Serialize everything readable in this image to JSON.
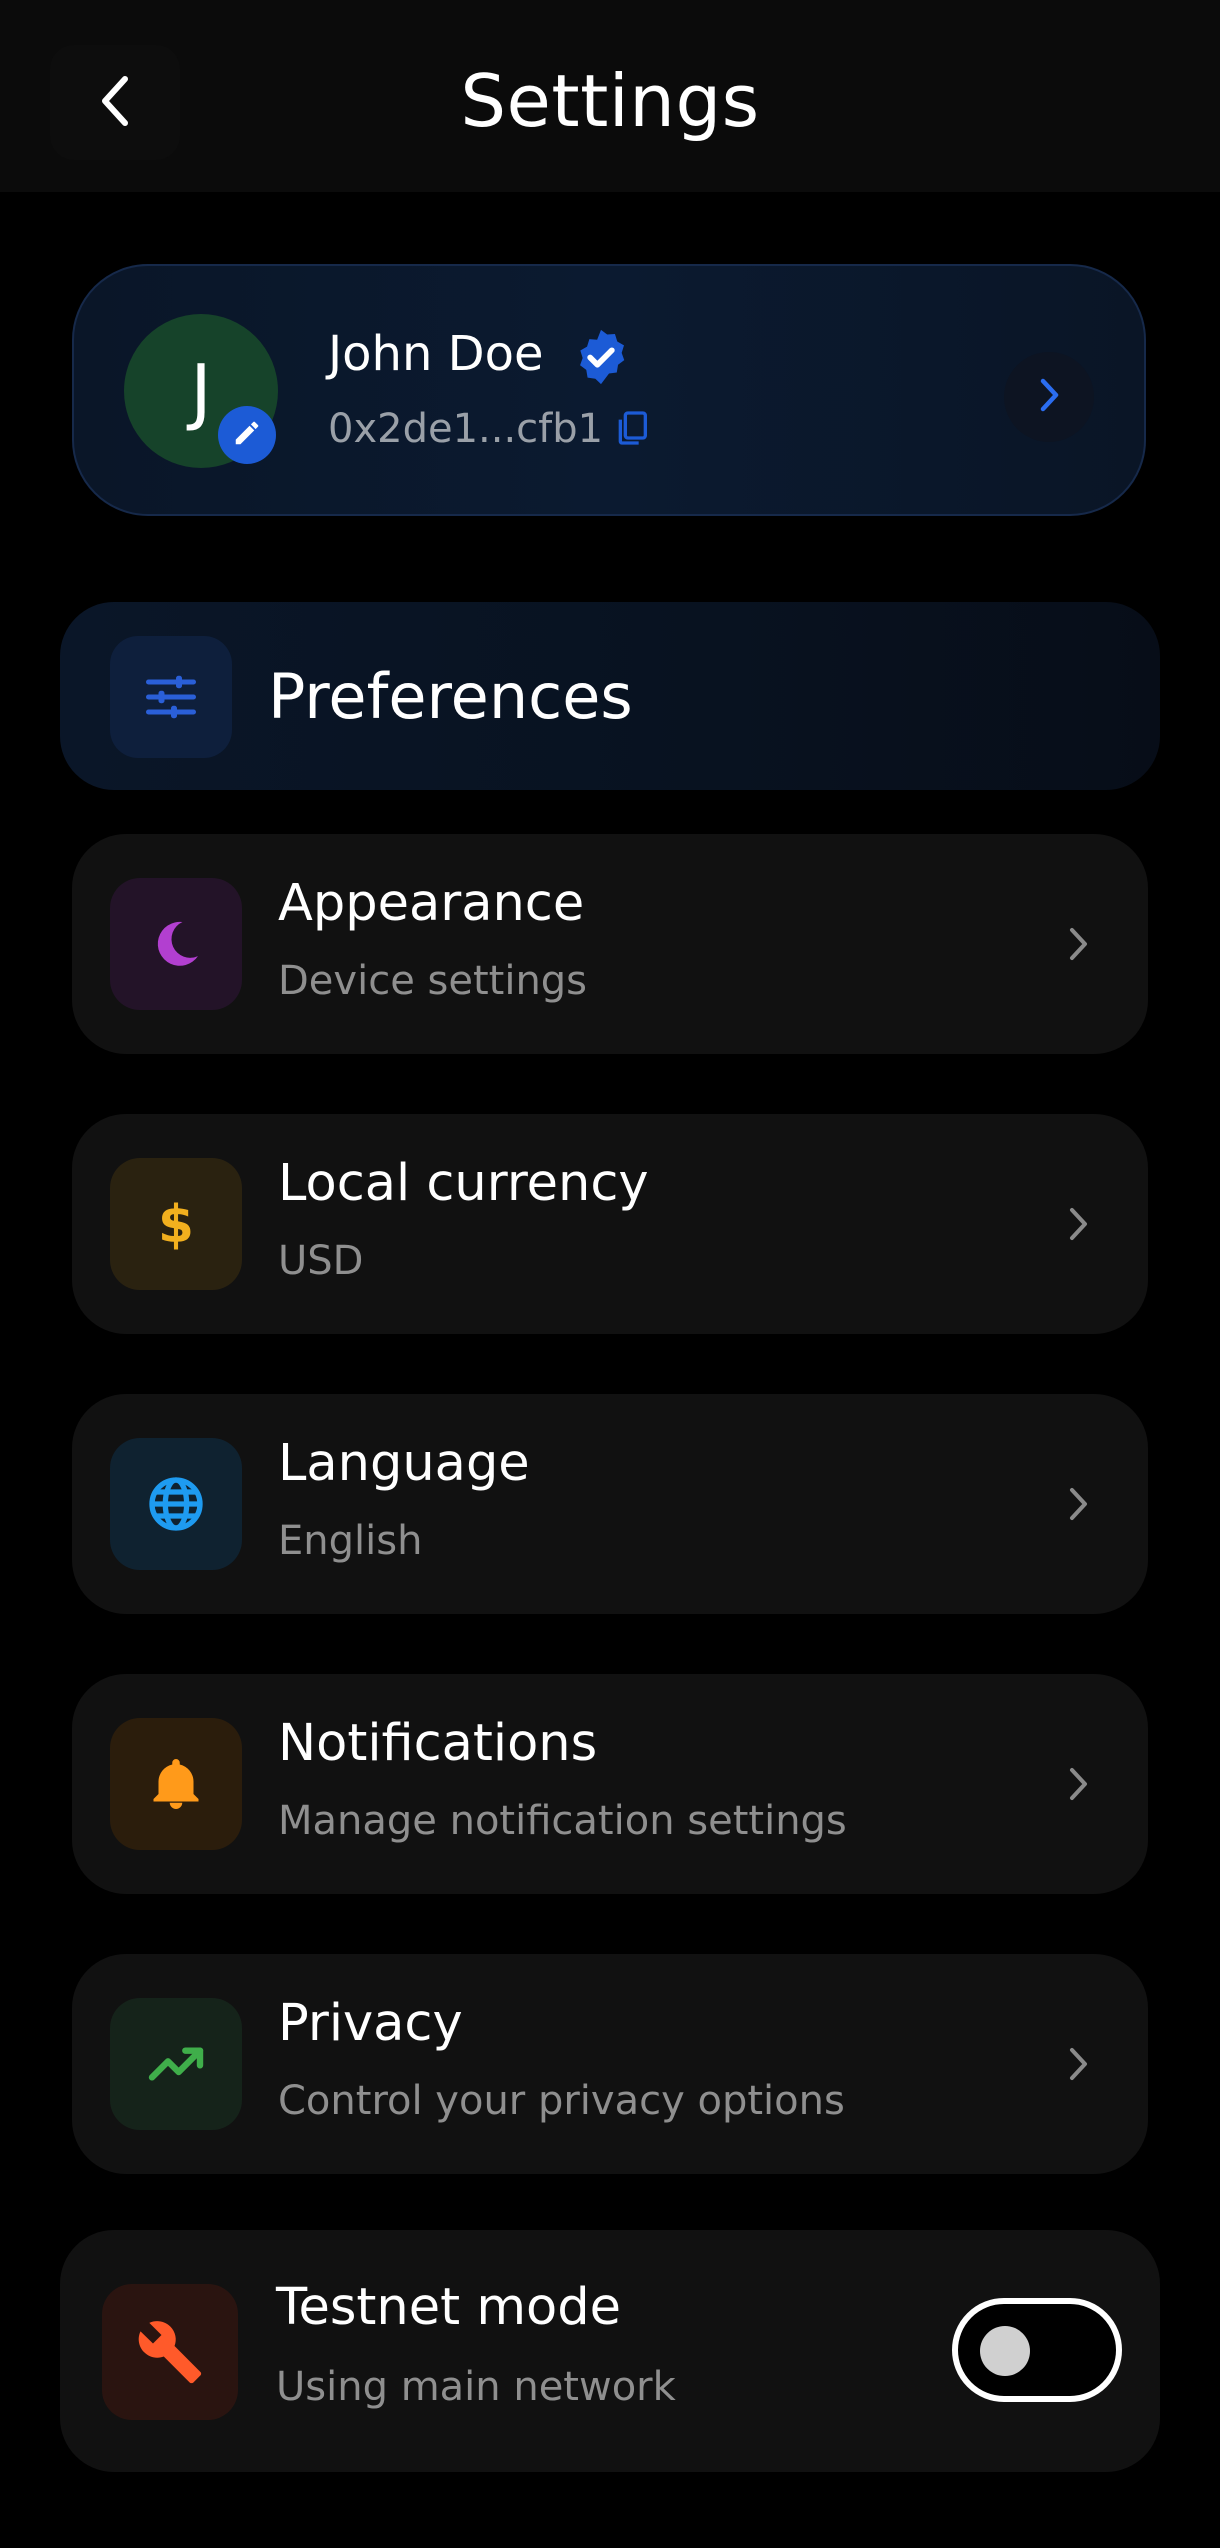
{
  "header": {
    "title": "Settings",
    "back_icon": "chevron-left-icon"
  },
  "profile": {
    "initial": "J",
    "name": "John Doe",
    "address": "0x2de1...cfb1",
    "verified": true,
    "avatar_color": "#16432a",
    "accent_color": "#1c5bd6"
  },
  "section": {
    "title": "Preferences",
    "icon": "sliders-icon"
  },
  "settings": [
    {
      "title": "Appearance",
      "subtitle": "Device settings",
      "icon": "moon-icon",
      "icon_color": "#b23fd0",
      "icon_bg": "#231328"
    },
    {
      "title": "Local currency",
      "subtitle": "USD",
      "icon": "dollar-icon",
      "icon_color": "#f2b01e",
      "icon_bg": "#2a2210"
    },
    {
      "title": "Language",
      "subtitle": "English",
      "icon": "globe-icon",
      "icon_color": "#1e9bf0",
      "icon_bg": "#0f2230"
    },
    {
      "title": "Notifications",
      "subtitle": "Manage notification settings",
      "icon": "bell-icon",
      "icon_color": "#ff9a1a",
      "icon_bg": "#2b1d0c"
    },
    {
      "title": "Privacy",
      "subtitle": "Control your privacy options",
      "icon": "trending-up-icon",
      "icon_color": "#3fae4a",
      "icon_bg": "#15231a"
    }
  ],
  "testnet": {
    "title": "Testnet mode",
    "subtitle": "Using main network",
    "icon": "wrench-icon",
    "icon_color": "#ff5a2a",
    "enabled": false
  }
}
